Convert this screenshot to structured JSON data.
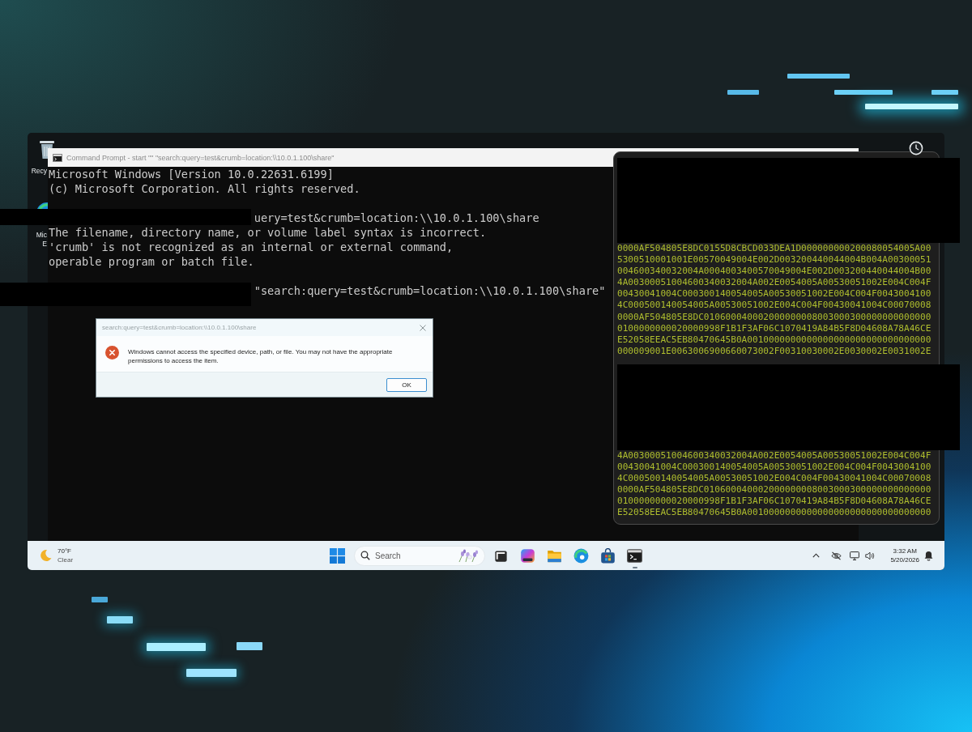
{
  "desktop": {
    "icons": [
      {
        "kind": "recycle-bin",
        "lines": [
          "Recy"
        ]
      },
      {
        "kind": "browser",
        "lines": [
          "Mic",
          "E"
        ]
      }
    ]
  },
  "command_prompt": {
    "title": "Command Prompt - start \"\" \"search:query=test&crumb=location:\\\\10.0.1.100\\share\"",
    "blocks": [
      [
        {
          "kind": "output",
          "text": "Microsoft Windows [Version 10.0.22631.6199]"
        },
        {
          "kind": "output",
          "text": "(c) Microsoft Corporation. All rights reserved."
        }
      ],
      [
        {
          "kind": "partly-hidden",
          "text": "uery=test&crumb=location:\\\\10.0.1.100\\share"
        },
        {
          "kind": "output",
          "text": "The filename, directory name, or volume label syntax is incorrect."
        },
        {
          "kind": "output",
          "text": "'crumb' is not recognized as an internal or external command,"
        },
        {
          "kind": "output",
          "text": "operable program or batch file."
        }
      ],
      [
        {
          "kind": "partly-hidden",
          "text": "\"search:query=test&crumb=location:\\\\10.0.1.100\\share\""
        }
      ]
    ]
  },
  "hex_terminal": {
    "blocks": [
      [
        "0000AF504805E8DC0155D8CBCD033DEA1D000000000200080054005A00",
        "5300510001001E00570049004E002D003200440044004B004A00300051",
        "004600340032004A0004003400570049004E002D003200440044004B00",
        "4A00300051004600340032004A002E0054005A00530051002E004C004F",
        "00430041004C000300140054005A00530051002E004C004F0043004100",
        "4C000500140054005A00530051002E004C004F00430041004C00070008",
        "0000AF504805E8DC010600040002000000008003000300000000000000",
        "0100000000020000998F1B1F3AF06C1070419A84B5F8D04608A78A46CE",
        "E52058EEAC5EB80470645B0A0010000000000000000000000000000000",
        "000009001E0063006900660073002F00310030002E0030002E0031002E"
      ],
      [
        "4A00300051004600340032004A002E0054005A00530051002E004C004F",
        "00430041004C000300140054005A00530051002E004C004F0043004100",
        "4C000500140054005A00530051002E004C004F00430041004C00070008",
        "0000AF504805E8DC010600040002000000008003000300000000000000",
        "0100000000020000998F1B1F3AF06C1070419A84B5F8D04608A78A46CE",
        "E52058EEAC5EB80470645B0A0010000000000000000000000000000000"
      ]
    ]
  },
  "error_dialog": {
    "title": "search:query=test&crumb=location:\\\\10.0.1.100\\share",
    "message": "Windows cannot access the specified device, path, or file. You may not have the appropriate permissions to access the item.",
    "buttons": [
      "OK"
    ]
  },
  "taskbar": {
    "weather": {
      "temperature": "70°F",
      "condition": "Clear"
    },
    "search": {
      "placeholder": "Search"
    },
    "apps": [
      {
        "kind": "task-view",
        "running": false
      },
      {
        "kind": "colorful-app",
        "running": false
      },
      {
        "kind": "folder",
        "running": false
      },
      {
        "kind": "browser",
        "running": false
      },
      {
        "kind": "store",
        "running": false
      },
      {
        "kind": "terminal",
        "running": true
      }
    ],
    "clock": {
      "time": "3:32 AM",
      "date": "5/20/2026"
    }
  }
}
